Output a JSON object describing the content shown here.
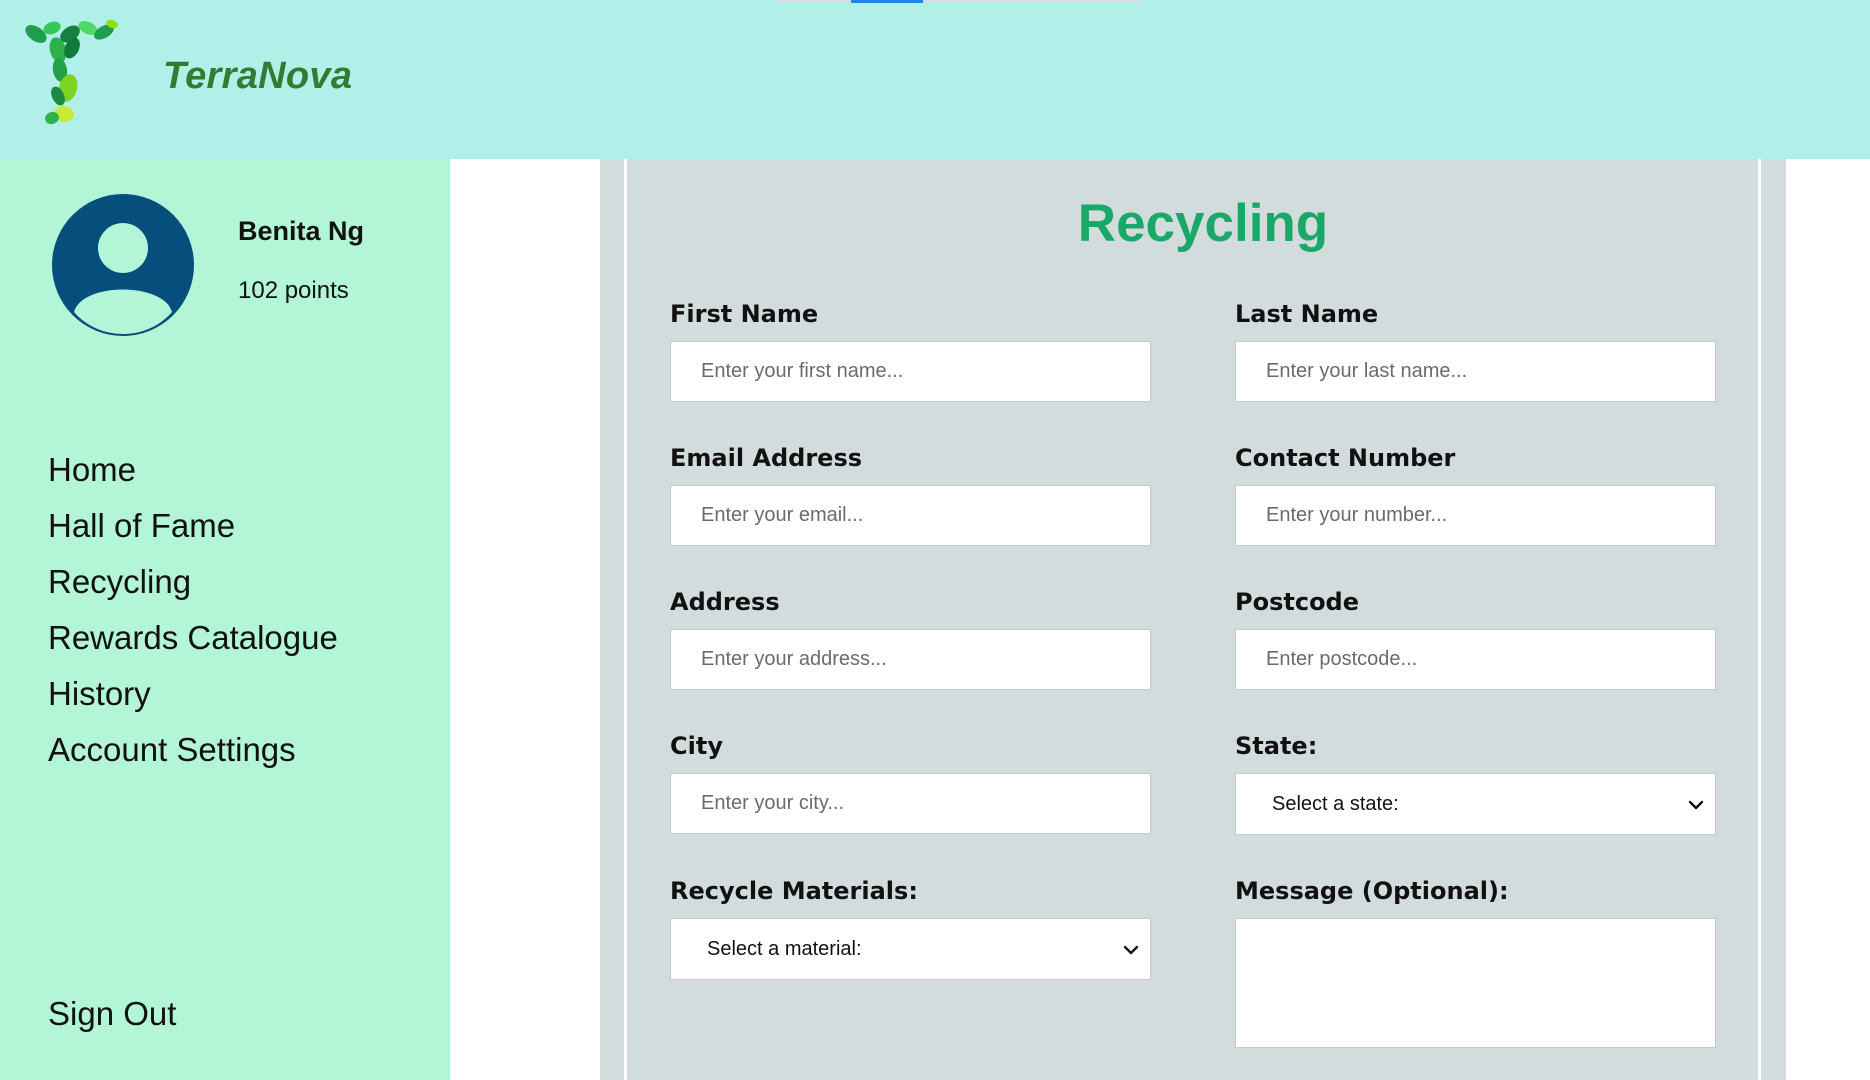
{
  "header": {
    "brand": "TerraNova",
    "logo_icon": "leaf-letter-t-logo",
    "brand_color": "#2e7d32",
    "background": "#b1f0e8"
  },
  "profile": {
    "name": "Benita Ng",
    "points": "102 points",
    "avatar_icon": "user-avatar-icon",
    "avatar_color": "#064e7c"
  },
  "sidebar": {
    "background": "#b3f5d7",
    "items": [
      {
        "label": "Home"
      },
      {
        "label": "Hall of Fame"
      },
      {
        "label": "Recycling"
      },
      {
        "label": "Rewards Catalogue"
      },
      {
        "label": "History"
      },
      {
        "label": "Account Settings"
      }
    ],
    "sign_out": "Sign Out"
  },
  "form": {
    "title": "Recycling",
    "title_color": "#19a86a",
    "first_name": {
      "label": "First Name",
      "placeholder": "Enter your first name..."
    },
    "last_name": {
      "label": "Last Name",
      "placeholder": "Enter your last name..."
    },
    "email": {
      "label": "Email Address",
      "placeholder": "Enter your email..."
    },
    "contact": {
      "label": "Contact Number",
      "placeholder": "Enter your number..."
    },
    "address": {
      "label": "Address",
      "placeholder": "Enter your address..."
    },
    "postcode": {
      "label": "Postcode",
      "placeholder": "Enter postcode..."
    },
    "city": {
      "label": "City",
      "placeholder": "Enter your city..."
    },
    "state": {
      "label": "State:",
      "selected": "Select a state:"
    },
    "materials": {
      "label": "Recycle Materials:",
      "selected": "Select a material:"
    },
    "message": {
      "label": "Message (Optional):",
      "value": ""
    }
  }
}
